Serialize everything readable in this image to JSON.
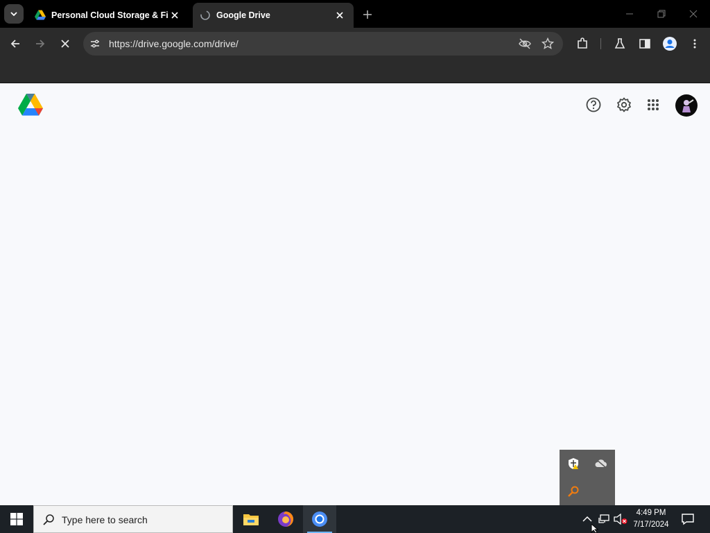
{
  "browser": {
    "tabs": [
      {
        "title": "Personal Cloud Storage & File",
        "active": false,
        "favicon": "drive-icon"
      },
      {
        "title": "Google Drive",
        "active": true,
        "favicon": "loading-globe-icon"
      }
    ],
    "url": "https://drive.google.com/drive/"
  },
  "page": {
    "logo": "google-drive-logo",
    "header_icons": [
      "help-icon",
      "settings-icon",
      "apps-grid-icon",
      "account-avatar"
    ]
  },
  "tray_popup": {
    "icons": [
      "security-shield-icon",
      "cloud-offline-icon",
      "search-tool-icon"
    ]
  },
  "taskbar": {
    "search_placeholder": "Type here to search",
    "apps": [
      "file-explorer-icon",
      "firefox-icon",
      "chrome-icon"
    ],
    "time": "4:49 PM",
    "date": "7/17/2024"
  },
  "colors": {
    "chrome_bg": "#2b2b2b",
    "tabstrip_bg": "#000000",
    "page_bg": "#f8f9fc",
    "taskbar_bg": "#1c2126"
  }
}
